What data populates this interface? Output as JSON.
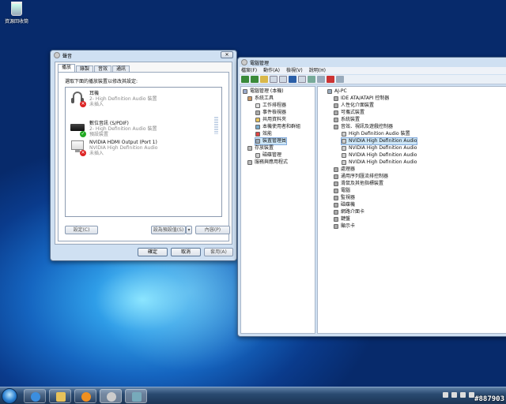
{
  "desktop": {
    "recycle_bin_label": "資源回收筒"
  },
  "sound_dialog": {
    "title": "聲音",
    "close": "✕",
    "tabs": [
      "播放",
      "錄製",
      "音效",
      "通訊"
    ],
    "instruction": "選取下面的播放裝置以修改其設定:",
    "devices": [
      {
        "name": "耳機",
        "desc": "2- High Definition Audio 裝置",
        "status": "未插入",
        "icon": "headphones-icon",
        "badge": "✕",
        "badge_color": "#d22222"
      },
      {
        "name": "數位音訊 (S/PDIF)",
        "desc": "2- High Definition Audio 裝置",
        "status": "預設裝置",
        "icon": "spdif-device-icon",
        "badge": "✓",
        "badge_color": "#22aa22"
      },
      {
        "name": "NVIDIA HDMI Output (Port 1)",
        "desc": "NVIDIA High Definition Audio",
        "status": "未插入",
        "icon": "monitor-icon",
        "badge": "✕",
        "badge_color": "#d22222"
      }
    ],
    "configure_btn": "設定(C)",
    "set_default_btn": "設為預設值(S)",
    "properties_btn": "內容(P)",
    "ok_btn": "確定",
    "cancel_btn": "取消",
    "apply_btn": "套用(A)"
  },
  "device_manager": {
    "title": "電腦管理",
    "menu": [
      "檔案(F)",
      "動作(A)",
      "檢視(V)",
      "說明(H)"
    ],
    "left_tree": [
      {
        "label": "電腦管理 (本機)",
        "icon": "computer-management-icon"
      },
      {
        "label": "系統工具",
        "icon": "tools-icon"
      },
      {
        "label": "工作排程器",
        "icon": "clock-icon"
      },
      {
        "label": "事件檢視器",
        "icon": "event-icon"
      },
      {
        "label": "共用資料夾",
        "icon": "folder-icon"
      },
      {
        "label": "本機使用者和群組",
        "icon": "users-icon"
      },
      {
        "label": "效能",
        "icon": "performance-icon"
      },
      {
        "label": "裝置管理員",
        "icon": "device-manager-icon"
      },
      {
        "label": "存放裝置",
        "icon": "storage-icon"
      },
      {
        "label": "磁碟管理",
        "icon": "disk-icon"
      },
      {
        "label": "服務與應用程式",
        "icon": "services-icon"
      }
    ],
    "right_tree": [
      {
        "label": "AJ-PC"
      },
      {
        "label": "IDE ATA/ATAPI 控制器"
      },
      {
        "label": "人性化介面裝置"
      },
      {
        "label": "可攜式裝置"
      },
      {
        "label": "系統裝置"
      },
      {
        "label": "音效、視訊及遊戲控制器"
      },
      {
        "label": "High Definition Audio 裝置"
      },
      {
        "label": "NVIDIA High Definition Audio"
      },
      {
        "label": "NVIDIA High Definition Audio"
      },
      {
        "label": "NVIDIA High Definition Audio"
      },
      {
        "label": "NVIDIA High Definition Audio"
      },
      {
        "label": "處理器"
      },
      {
        "label": "通用序列匯流排控制器"
      },
      {
        "label": "滑鼠及其他指標裝置"
      },
      {
        "label": "電腦"
      },
      {
        "label": "監視器"
      },
      {
        "label": "磁碟機"
      },
      {
        "label": "網路介面卡"
      },
      {
        "label": "鍵盤"
      },
      {
        "label": "顯示卡"
      }
    ]
  },
  "taskbar": {
    "watermark": "#887903"
  },
  "colors": {
    "accent": "#1565c0",
    "selected_row": "#cde6f7"
  }
}
